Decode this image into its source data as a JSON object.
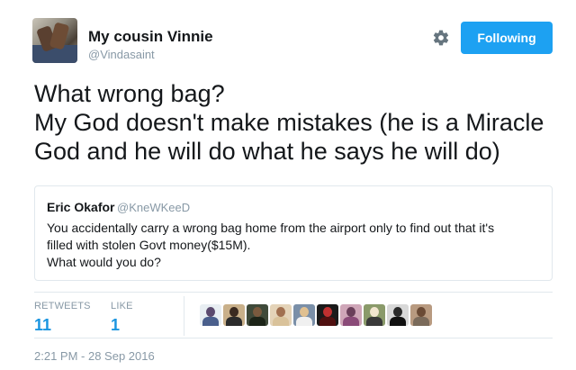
{
  "author": {
    "display_name": "My cousin Vinnie",
    "handle": "@Vindasaint"
  },
  "actions": {
    "follow_label": "Following",
    "settings_icon": "gear-icon"
  },
  "tweet": {
    "text_lines": [
      "What wrong bag?",
      "My God doesn't make mistakes (he is a Miracle",
      "God and he will do what he says he will do)"
    ]
  },
  "quoted_tweet": {
    "display_name": "Eric Okafor",
    "handle": "@KneWKeeD",
    "text_lines": [
      "You accidentally carry a wrong bag home from the airport only to find out that it's",
      "filled with stolen Govt money($15M).",
      "What would you do?"
    ]
  },
  "stats": {
    "retweets_label": "RETWEETS",
    "retweets_count": "11",
    "likes_label": "LIKE",
    "likes_count": "1"
  },
  "engaged_users": [
    {
      "bg": "#e8eef2",
      "skin": "#5b4a6e",
      "shirt": "#4a5f8c"
    },
    {
      "bg": "#c9b08a",
      "skin": "#3a2a20",
      "shirt": "#2b2b2b"
    },
    {
      "bg": "#3f4a3a",
      "skin": "#7a5a3e",
      "shirt": "#1c2418"
    },
    {
      "bg": "#e4d3b8",
      "skin": "#a17050",
      "shirt": "#d9c29a"
    },
    {
      "bg": "#7a8fa8",
      "skin": "#e0c090",
      "shirt": "#f0f0f0"
    },
    {
      "bg": "#1a1a1a",
      "skin": "#c03030",
      "shirt": "#501010"
    },
    {
      "bg": "#cfa6b8",
      "skin": "#6a3f5a",
      "shirt": "#8a4a78"
    },
    {
      "bg": "#8a9a6a",
      "skin": "#f2e6d0",
      "shirt": "#3a3a3a"
    },
    {
      "bg": "#d8d8d8",
      "skin": "#2a2a2a",
      "shirt": "#111111"
    },
    {
      "bg": "#b89a80",
      "skin": "#6a4a35",
      "shirt": "#7a6a5a"
    }
  ],
  "timestamp": "2:21 PM - 28 Sep 2016",
  "colors": {
    "accent": "#1da1f2",
    "link": "#1b95e0",
    "muted": "#8899a6",
    "border": "#e1e8ed"
  }
}
